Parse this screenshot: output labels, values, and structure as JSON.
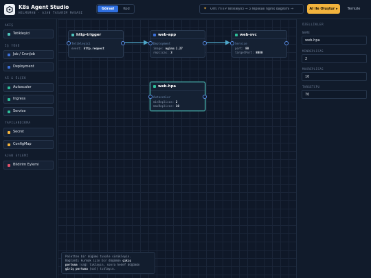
{
  "header": {
    "title": "K8s Agent Studio",
    "subtitle": "HELMSMAN · AJAN TASARIM MASASI",
    "mode_visual": "Görsel",
    "mode_code": "Kod",
    "prompt_placeholder": "Örn: HTTP tetikleyici → 3 replikalı nginx dağıtımı →",
    "ai_button": "AI ile Oluştur ▸",
    "clear_button": "Temizle"
  },
  "sidebar": {
    "sections": [
      {
        "title": "AKIŞ",
        "items": [
          {
            "label": "Tetikleyici",
            "color": "#4ec3bc"
          }
        ]
      },
      {
        "title": "İŞ YÜKÜ",
        "items": [
          {
            "label": "Job / CronJob",
            "color": "#3b6fd8"
          },
          {
            "label": "Deployment",
            "color": "#3b6fd8"
          }
        ]
      },
      {
        "title": "AĞ & ÖLÇEK",
        "items": [
          {
            "label": "Autoscaler",
            "color": "#2fbf9a"
          },
          {
            "label": "Ingress",
            "color": "#2fbf9a"
          },
          {
            "label": "Service",
            "color": "#2fbf9a"
          }
        ]
      },
      {
        "title": "YAPILANDIRMA",
        "items": [
          {
            "label": "Secret",
            "color": "#f2b33d"
          },
          {
            "label": "ConfigMap",
            "color": "#f2b33d"
          }
        ]
      },
      {
        "title": "AJAN EYLEMİ",
        "items": [
          {
            "label": "Bildirim Eylemi",
            "color": "#e0526b"
          }
        ]
      }
    ]
  },
  "nodes": [
    {
      "title": "http-trigger",
      "kind": "Tetikleyici",
      "color": "#4ec3bc",
      "rows": [
        {
          "key": "event:",
          "value": "http.request"
        }
      ]
    },
    {
      "title": "web-app",
      "kind": "Deployment",
      "color": "#3b6fd8",
      "rows": [
        {
          "key": "image:",
          "value": "nginx:1.27"
        },
        {
          "key": "replicas:",
          "value": "3"
        }
      ]
    },
    {
      "title": "web-svc",
      "kind": "Service",
      "color": "#2fbf9a",
      "rows": [
        {
          "key": "port:",
          "value": "80"
        },
        {
          "key": "targetPort:",
          "value": "8080"
        }
      ]
    },
    {
      "title": "web-hpa",
      "kind": "Autoscaler",
      "color": "#2fbf9a",
      "rows": [
        {
          "key": "minReplicas:",
          "value": "2"
        },
        {
          "key": "maxReplicas:",
          "value": "10"
        }
      ]
    }
  ],
  "hint": {
    "l1": "Paletten bir düğümü tuvale sürükleyin.",
    "l2a": "Bağlantı kurmak için bir düğümün ",
    "l2b": "çıkış",
    "l3a": "portuna",
    "l3b": " (sağ) tıklayın, sonra hedef düğümün",
    "l4a": "giriş portuna",
    "l4b": " (sol) tıklayın."
  },
  "properties": {
    "title": "ÖZELLİKLER",
    "fields": [
      {
        "label": "NAME",
        "value": "web-hpa"
      },
      {
        "label": "MINREPLICAS",
        "value": "2"
      },
      {
        "label": "MAXREPLICAS",
        "value": "10"
      },
      {
        "label": "TARGETCPU",
        "value": "70"
      }
    ]
  }
}
